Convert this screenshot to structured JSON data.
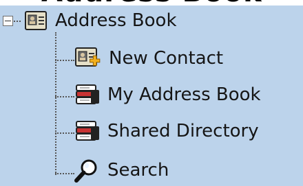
{
  "header": {
    "partial_title": "Address Book"
  },
  "tree": {
    "root": {
      "label": "Address Book",
      "expanded": true,
      "icon": "address-book-icon"
    },
    "children": [
      {
        "label": "New Contact",
        "icon": "new-contact-icon"
      },
      {
        "label": "My Address Book",
        "icon": "address-book-stack-icon"
      },
      {
        "label": "Shared Directory",
        "icon": "shared-directory-icon"
      },
      {
        "label": "Search",
        "icon": "magnifier-icon"
      }
    ]
  },
  "colors": {
    "panel_bg": "#bcd3eb",
    "text": "#151515",
    "tree_lines": "#555555"
  }
}
